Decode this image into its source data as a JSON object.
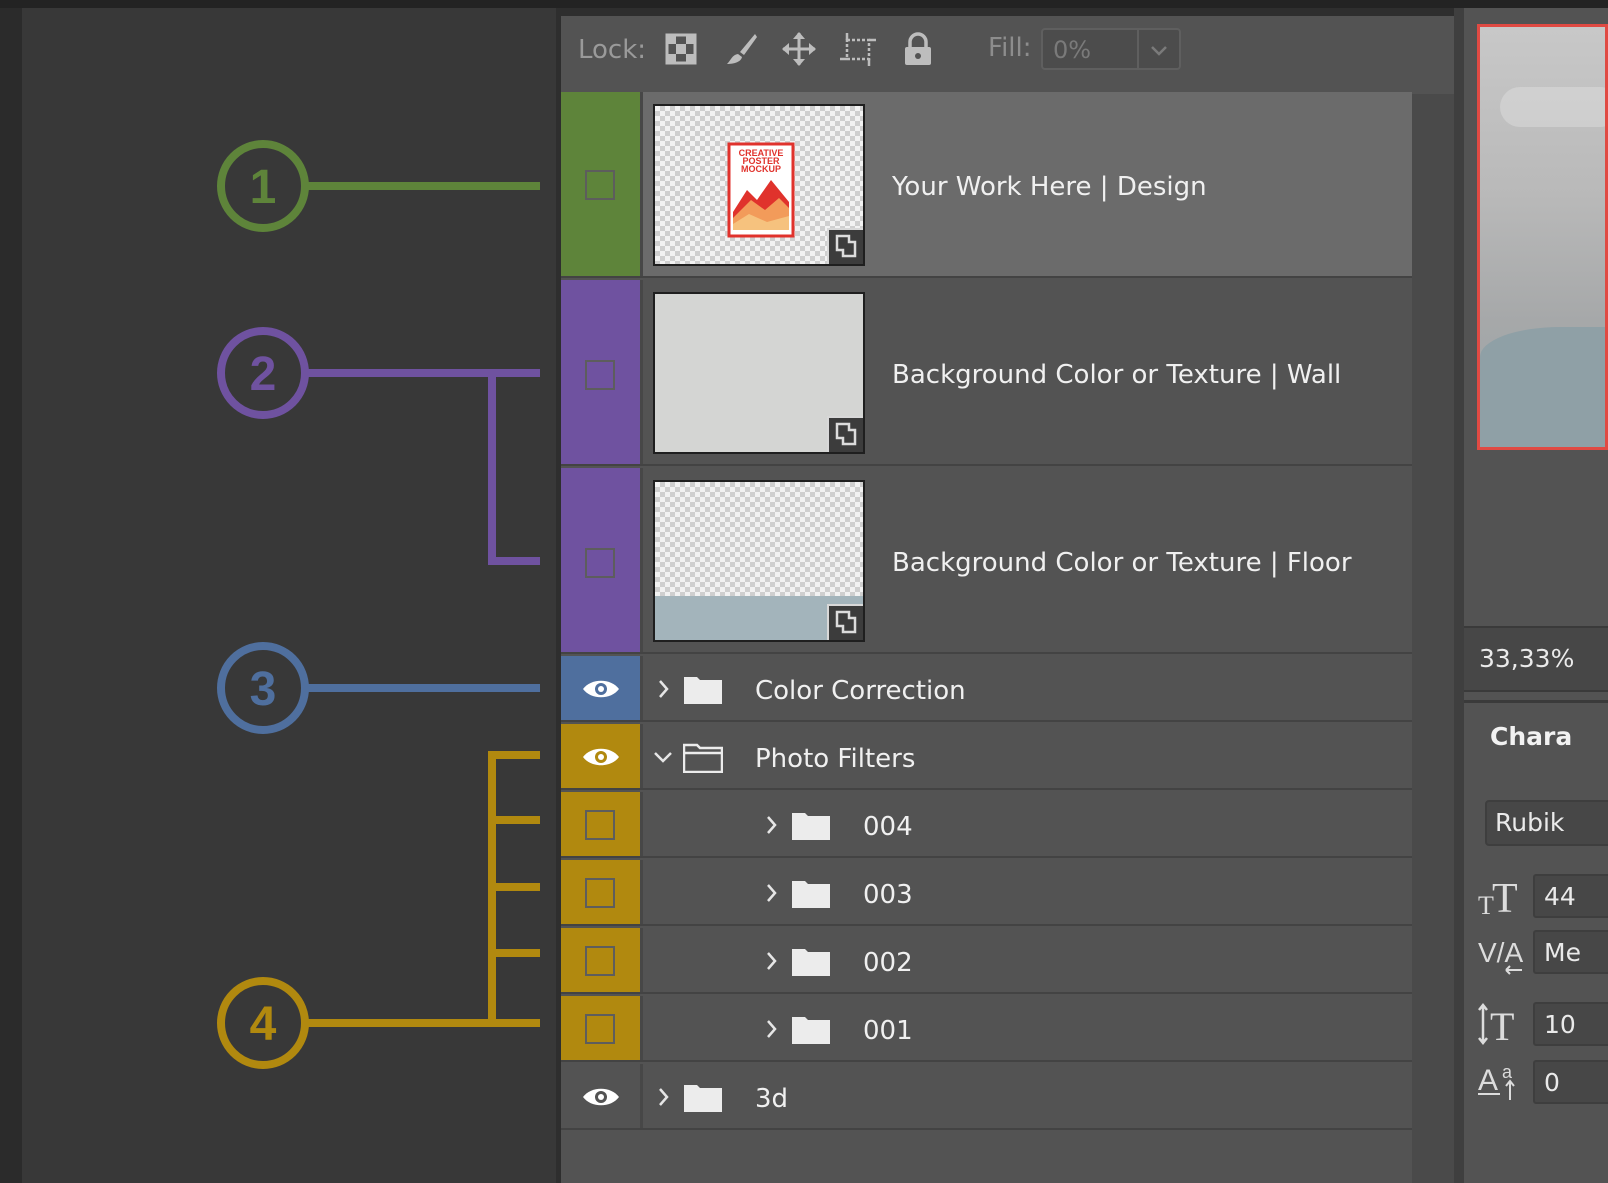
{
  "colors": {
    "green": "#5e843a",
    "purple": "#6f52a0",
    "blue": "#4f6f9e",
    "gold": "#b1890f",
    "selected_row": "#6b6b6b",
    "row": "#535353",
    "nav_border": "#e04a43"
  },
  "annotations": [
    {
      "number": "1",
      "color": "green"
    },
    {
      "number": "2",
      "color": "purple"
    },
    {
      "number": "3",
      "color": "blue"
    },
    {
      "number": "4",
      "color": "gold"
    }
  ],
  "lockbar": {
    "lock_label": "Lock:",
    "icons": [
      "lock-transparent-pixels-icon",
      "lock-image-pixels-icon",
      "lock-position-icon",
      "lock-artboard-icon",
      "lock-all-icon"
    ],
    "fill_label": "Fill:",
    "fill_value": "0%"
  },
  "layers": [
    {
      "name": "Your Work Here | Design",
      "kind": "smart-object",
      "visible": false,
      "color": "green",
      "selected": true
    },
    {
      "name": "Background Color or Texture | Wall",
      "kind": "smart-object",
      "visible": false,
      "color": "purple"
    },
    {
      "name": "Background Color or Texture | Floor",
      "kind": "smart-object",
      "visible": false,
      "color": "purple"
    },
    {
      "name": "Color Correction",
      "kind": "group",
      "visible": true,
      "expanded": false,
      "color": "blue"
    },
    {
      "name": "Photo Filters",
      "kind": "group",
      "visible": true,
      "expanded": true,
      "color": "gold"
    },
    {
      "name": "004",
      "kind": "group",
      "visible": false,
      "expanded": false,
      "color": "gold",
      "indent": true
    },
    {
      "name": "003",
      "kind": "group",
      "visible": false,
      "expanded": false,
      "color": "gold",
      "indent": true
    },
    {
      "name": "002",
      "kind": "group",
      "visible": false,
      "expanded": false,
      "color": "gold",
      "indent": true
    },
    {
      "name": "001",
      "kind": "group",
      "visible": false,
      "expanded": false,
      "color": "gold",
      "indent": true
    },
    {
      "name": "3d",
      "kind": "group",
      "visible": true,
      "expanded": false,
      "color": "none"
    }
  ],
  "poster_thumb": {
    "line1": "CREATIVE",
    "line2": "POSTER",
    "line3": "MOCKUP"
  },
  "navigator": {
    "zoom": "33,33%"
  },
  "character": {
    "title": "Chara",
    "font": "Rubik",
    "size": "44",
    "kerning": "Me",
    "leading": "10",
    "baseline": "0"
  }
}
